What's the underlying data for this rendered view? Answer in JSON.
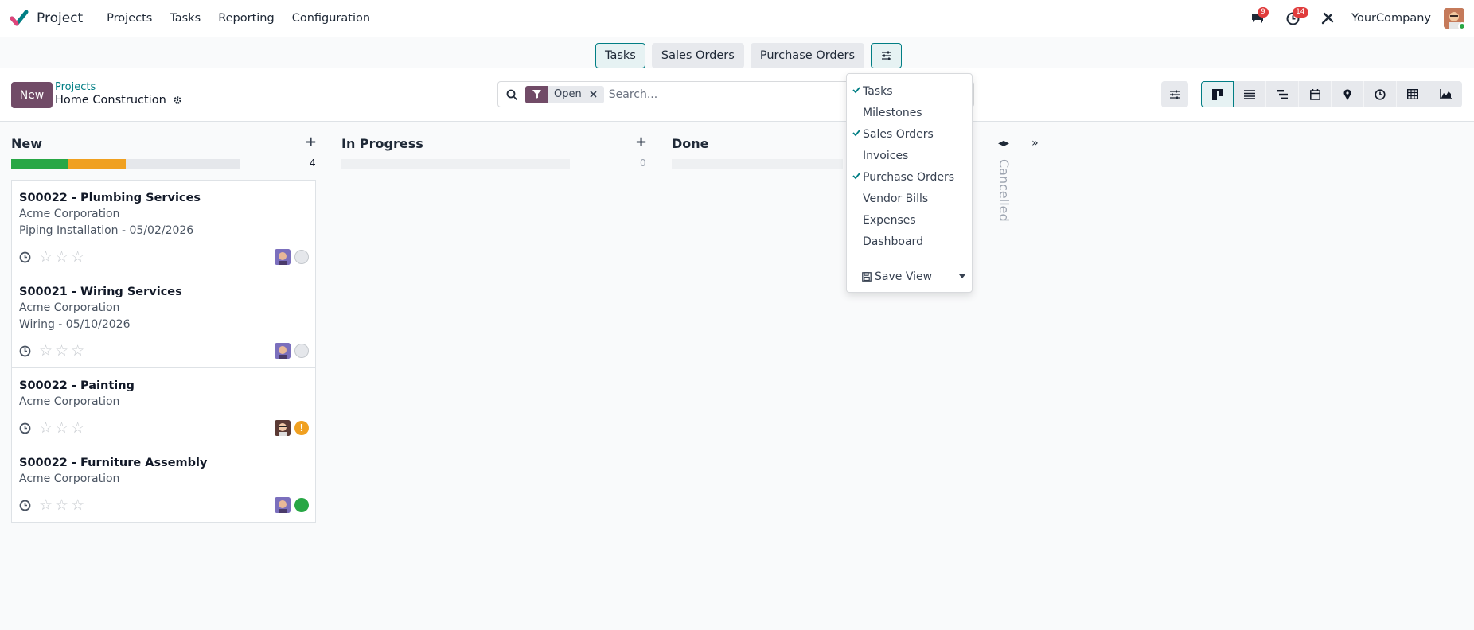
{
  "app": {
    "name": "Project"
  },
  "menu": [
    "Projects",
    "Tasks",
    "Reporting",
    "Configuration"
  ],
  "systray": {
    "messages_count": "9",
    "activities_count": "14",
    "company": "YourCompany"
  },
  "embedded_actions": {
    "tasks": "Tasks",
    "sales_orders": "Sales Orders",
    "purchase_orders": "Purchase Orders"
  },
  "control": {
    "new_label": "New",
    "breadcrumb_parent": "Projects",
    "breadcrumb_current": "Home Construction"
  },
  "search": {
    "facet": "Open",
    "placeholder": "Search..."
  },
  "columns": {
    "new": {
      "title": "New",
      "count": "4",
      "progress": {
        "done": 0.25,
        "in_progress": 0.25
      }
    },
    "in_progress": {
      "title": "In Progress",
      "count": "0"
    },
    "done": {
      "title": "Done",
      "count": "0"
    },
    "cancelled": {
      "title": "Cancelled"
    }
  },
  "cards": [
    {
      "title": "S00022 - Plumbing Services",
      "customer": "Acme Corporation",
      "extra": "Piping Installation - 05/02/2026",
      "priority": 0,
      "state": "normal"
    },
    {
      "title": "S00021 - Wiring Services",
      "customer": "Acme Corporation",
      "extra": "Wiring - 05/10/2026",
      "priority": 0,
      "state": "normal"
    },
    {
      "title": "S00022 - Painting",
      "customer": "Acme Corporation",
      "extra": "",
      "priority": 0,
      "state": "changes_requested"
    },
    {
      "title": "S00022 - Furniture Assembly",
      "customer": "Acme Corporation",
      "extra": "",
      "priority": 0,
      "state": "approved"
    }
  ],
  "dropdown": {
    "items": [
      {
        "label": "Tasks",
        "checked": true
      },
      {
        "label": "Milestones",
        "checked": false
      },
      {
        "label": "Sales Orders",
        "checked": true
      },
      {
        "label": "Invoices",
        "checked": false
      },
      {
        "label": "Purchase Orders",
        "checked": true
      },
      {
        "label": "Vendor Bills",
        "checked": false
      },
      {
        "label": "Expenses",
        "checked": false
      },
      {
        "label": "Dashboard",
        "checked": false
      }
    ],
    "save_view": "Save View"
  },
  "colors": {
    "brand": "#714b67",
    "accent": "#017e84",
    "green": "#28a745",
    "orange": "#f0a020",
    "badge": "#e03c3c"
  }
}
